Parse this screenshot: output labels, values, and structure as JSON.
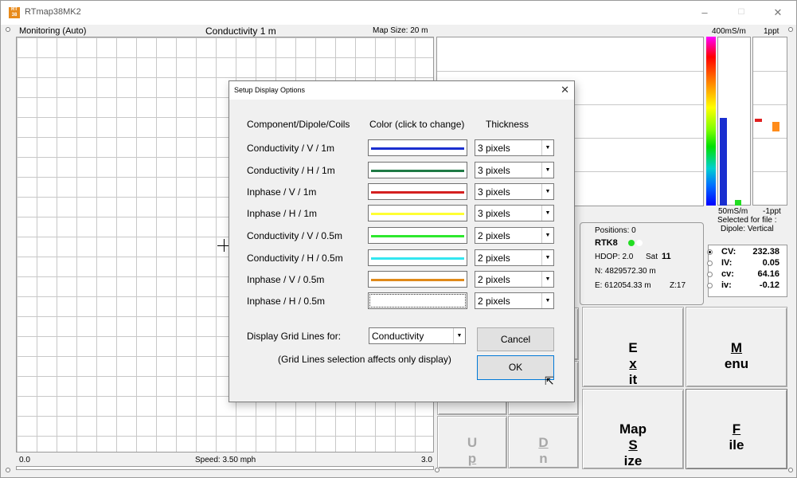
{
  "window": {
    "title": "RTmap38MK2",
    "icon_text": "RT 38",
    "minimize": "–",
    "maximize": "☐",
    "close": "✕"
  },
  "map": {
    "mode_label": "Monitoring (Auto)",
    "title": "Conductivity 1 m",
    "map_size_label": "Map Size:  20 m",
    "scale_left": "0.0",
    "scale_right": "3.0",
    "speed_label": "Speed:  3.50 mph"
  },
  "graph": {
    "top_left_label": "400mS/m",
    "top_right_label": "1ppt",
    "bottom_left_label": "50mS/m",
    "bottom_right_label": "-1ppt",
    "selected_for_file_label": "Selected for file :",
    "dipole_label": "Dipole: Vertical",
    "colors": {
      "bar_blue": "#1a2fd0",
      "bar_green": "#22dd22",
      "ppt_red": "#e02020",
      "ppt_orange": "#ff8c1a"
    }
  },
  "status": {
    "positions": "Positions:  0",
    "rtk": "RTK8",
    "hdop": "HDOP: 2.0",
    "sat_label": "Sat",
    "sat_value": "11",
    "northing": "N: 4829572.30 m",
    "easting": "E:  612054.33 m",
    "z": "Z:17",
    "indicator_color": "#22dd22"
  },
  "readouts": [
    {
      "label": "CV:",
      "value": "232.38",
      "selected": true
    },
    {
      "label": "IV:",
      "value": "0.05",
      "selected": false
    },
    {
      "label": "cv:",
      "value": "64.16",
      "selected": false
    },
    {
      "label": "iv:",
      "value": "-0.12",
      "selected": false
    }
  ],
  "buttons": {
    "exit_pre": "E",
    "exit_ul": "x",
    "exit_post": "it",
    "menu_ul": "M",
    "menu_post": "enu",
    "mapsize_pre": "Map ",
    "mapsize_ul": "S",
    "mapsize_post": "ize",
    "file_ul": "F",
    "file_post": "ile",
    "up_pre": "U",
    "up_ul": "p",
    "dn_pre": "",
    "dn_ul": "D",
    "dn_post": "n"
  },
  "dialog": {
    "title": "Setup Display Options",
    "close": "✕",
    "col_component": "Component/Dipole/Coils",
    "col_color": "Color (click to change)",
    "col_thickness": "Thickness",
    "rows": [
      {
        "label": "Conductivity / V / 1m",
        "color": "#1a2fd0",
        "thickness": "3 pixels"
      },
      {
        "label": "Conductivity / H / 1m",
        "color": "#1f7a45",
        "thickness": "3 pixels"
      },
      {
        "label": "Inphase / V / 1m",
        "color": "#d42020",
        "thickness": "3 pixels"
      },
      {
        "label": "Inphase / H / 1m",
        "color": "#ffff33",
        "thickness": "3 pixels"
      },
      {
        "label": "Conductivity / V / 0.5m",
        "color": "#2ee82e",
        "thickness": "2 pixels"
      },
      {
        "label": "Conductivity / H / 0.5m",
        "color": "#33e6f0",
        "thickness": "2 pixels"
      },
      {
        "label": "Inphase / V / 0.5m",
        "color": "#e08a1a",
        "thickness": "2 pixels"
      },
      {
        "label": "Inphase / H / 0.5m",
        "color": "#ffffff",
        "thickness": "2 pixels"
      }
    ],
    "grid_label": "Display Grid Lines for:",
    "grid_value": "Conductivity",
    "grid_note": "(Grid Lines selection affects only display)",
    "cancel": "Cancel",
    "ok": "OK"
  }
}
